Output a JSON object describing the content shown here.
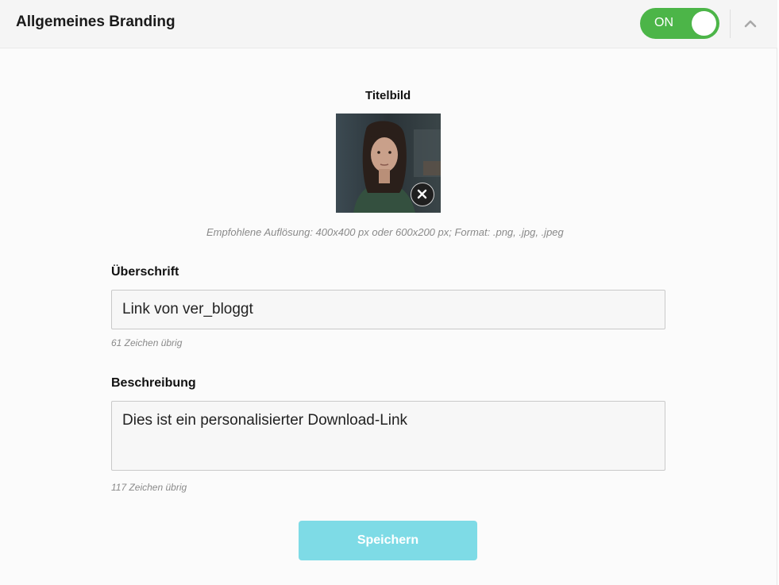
{
  "header": {
    "title": "Allgemeines Branding",
    "toggle_label": "ON",
    "toggle_on": true,
    "collapse_icon": "chevron-up-icon"
  },
  "branding": {
    "image_section_label": "Titelbild",
    "image_description": "portrait-photo",
    "remove_icon": "close-icon",
    "image_hint": "Empfohlene Auflösung: 400x400 px oder 600x200 px; Format: .png, .jpg, .jpeg",
    "headline_label": "Überschrift",
    "headline_value": "Link von ver_bloggt",
    "headline_remaining": "61 Zeichen übrig",
    "description_label": "Beschreibung",
    "description_value": "Dies ist ein personalisierter Download-Link",
    "description_remaining": "117 Zeichen übrig",
    "save_label": "Speichern"
  },
  "colors": {
    "toggle_on": "#4cb548",
    "save_button": "#7edbe6",
    "header_bg": "#f5f5f5"
  }
}
